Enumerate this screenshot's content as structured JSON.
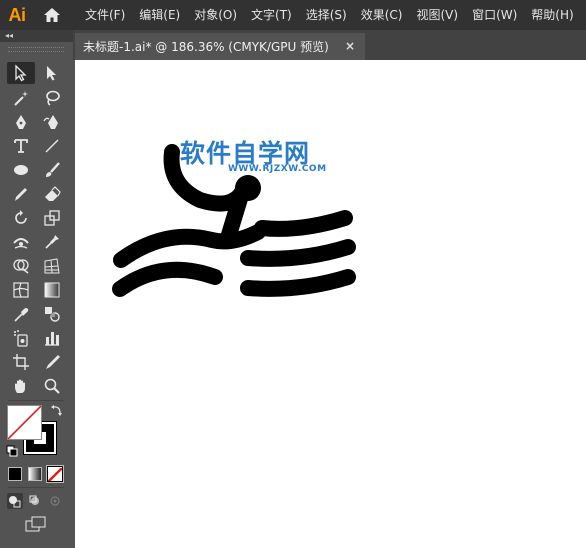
{
  "app": {
    "logo": "Ai"
  },
  "menu": [
    "文件(F)",
    "编辑(E)",
    "对象(O)",
    "文字(T)",
    "选择(S)",
    "效果(C)",
    "视图(V)",
    "窗口(W)",
    "帮助(H)"
  ],
  "panel": {
    "collapse": "◂◂"
  },
  "document": {
    "tab_title": "未标题-1.ai* @ 186.36% (CMYK/GPU 预览)",
    "close": "×"
  },
  "watermark": {
    "title": "软件自学网",
    "subtitle": "WWW.RJZXW.COM"
  },
  "colors": {
    "accent": "#FF9A00",
    "watermark": "#2b7cc7",
    "panel_bg": "#535353",
    "menubar_bg": "#323232"
  },
  "tools": [
    "selection-tool-icon",
    "direct-selection-tool-icon",
    "magic-wand-tool-icon",
    "lasso-tool-icon",
    "pen-tool-icon",
    "curvature-tool-icon",
    "type-tool-icon",
    "line-segment-tool-icon",
    "ellipse-tool-icon",
    "paintbrush-tool-icon",
    "pencil-tool-icon",
    "eraser-tool-icon",
    "rotate-tool-icon",
    "scale-tool-icon",
    "width-tool-icon",
    "puppet-warp-tool-icon",
    "shape-builder-tool-icon",
    "perspective-grid-tool-icon",
    "mesh-tool-icon",
    "gradient-tool-icon",
    "eyedropper-tool-icon",
    "blend-tool-icon",
    "symbol-sprayer-tool-icon",
    "column-graph-tool-icon",
    "artboard-tool-icon",
    "slice-tool-icon",
    "hand-tool-icon",
    "zoom-tool-icon"
  ]
}
